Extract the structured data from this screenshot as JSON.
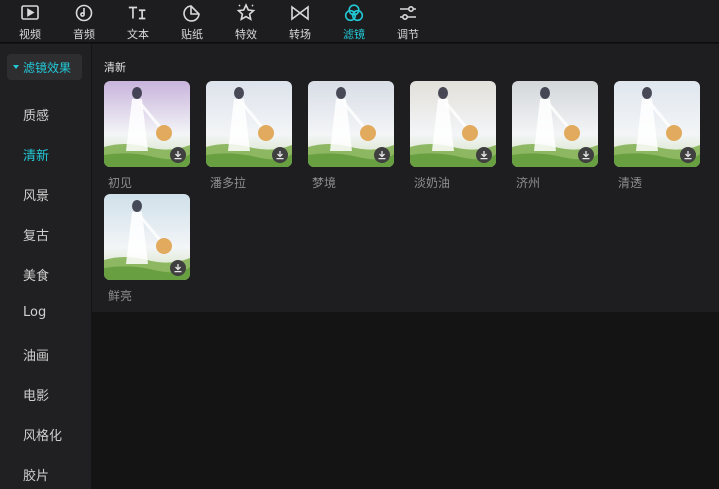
{
  "toolbar": {
    "items": [
      {
        "label": "视频",
        "icon": "video-icon"
      },
      {
        "label": "音频",
        "icon": "audio-icon"
      },
      {
        "label": "文本",
        "icon": "text-icon"
      },
      {
        "label": "贴纸",
        "icon": "sticker-icon"
      },
      {
        "label": "特效",
        "icon": "effects-icon"
      },
      {
        "label": "转场",
        "icon": "transition-icon"
      },
      {
        "label": "滤镜",
        "icon": "filter-icon",
        "active": true
      },
      {
        "label": "调节",
        "icon": "adjust-icon"
      }
    ],
    "accent_color": "#22c8d5"
  },
  "sidebar": {
    "header": "滤镜效果",
    "items": [
      {
        "label": "质感"
      },
      {
        "label": "清新",
        "active": true
      },
      {
        "label": "风景"
      },
      {
        "label": "复古"
      },
      {
        "label": "美食"
      },
      {
        "label": "Log"
      },
      {
        "label": "油画"
      },
      {
        "label": "电影"
      },
      {
        "label": "风格化"
      },
      {
        "label": "胶片"
      }
    ]
  },
  "main": {
    "section_title": "清新",
    "filters": [
      {
        "name": "初见",
        "tint": "#c8b3dc"
      },
      {
        "name": "潘多拉",
        "tint": "#dde3ec"
      },
      {
        "name": "梦境",
        "tint": "#d8dde6"
      },
      {
        "name": "淡奶油",
        "tint": "#e2e0da"
      },
      {
        "name": "济州",
        "tint": "#d3d6d9"
      },
      {
        "name": "清透",
        "tint": "#dfe6ee"
      },
      {
        "name": "鲜亮",
        "tint": "#cfe0ea"
      }
    ]
  }
}
